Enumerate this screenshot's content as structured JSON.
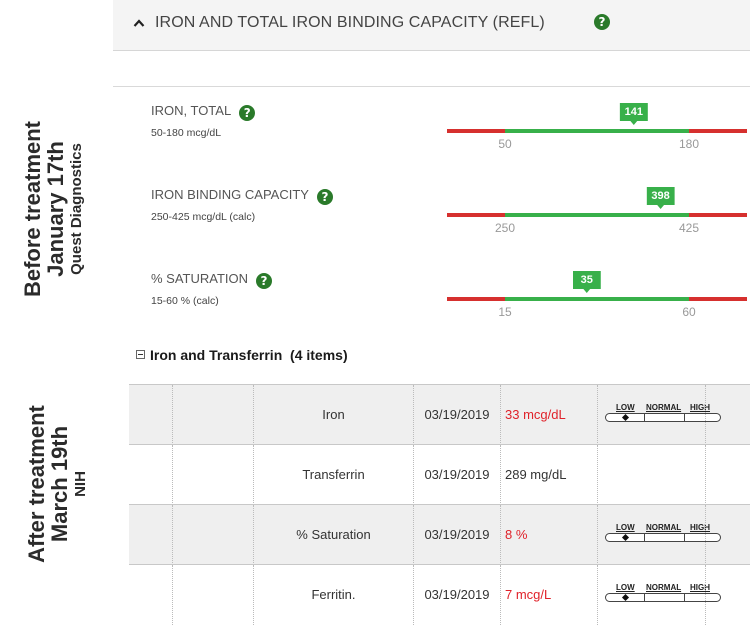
{
  "side_labels": {
    "before": {
      "line1": "Before treatment",
      "line2": "January 17th",
      "line3": "Quest Diagnostics"
    },
    "after": {
      "line1": "After treatment",
      "line2": "March 19th",
      "line3": "NIH"
    }
  },
  "panel": {
    "title": "IRON AND TOTAL IRON BINDING CAPACITY (REFL)",
    "collapse_icon": "chevron-up-icon",
    "help_icon": "question-circle-icon",
    "help_glyph": "?"
  },
  "results": [
    {
      "name": "IRON, TOTAL",
      "range": "50-180 mcg/dL",
      "low": 50,
      "high": 180,
      "low_label": "50",
      "high_label": "180",
      "value": 141,
      "value_label": "141"
    },
    {
      "name": "IRON BINDING CAPACITY",
      "range": "250-425 mcg/dL (calc)",
      "low": 250,
      "high": 425,
      "low_label": "250",
      "high_label": "425",
      "value": 398,
      "value_label": "398"
    },
    {
      "name": "% SATURATION",
      "range": "15-60 % (calc)",
      "low": 15,
      "high": 60,
      "low_label": "15",
      "high_label": "60",
      "value": 35,
      "value_label": "35"
    }
  ],
  "colors": {
    "in_range": "#38b04a",
    "out_of_range": "#d6302e",
    "abnormal_text": "#e0222a",
    "help": "#2a7a2a"
  },
  "group": {
    "title": "Iron and Transferrin",
    "count": "(4 items)",
    "toggle_icon": "collapse-box-icon",
    "scale_labels": {
      "low": "LOW",
      "normal": "NORMAL",
      "high": "HIGH"
    },
    "rows": [
      {
        "test": "Iron",
        "date": "03/19/2019",
        "result": "33 mcg/dL",
        "abnormal": true,
        "flag": "low",
        "shaded": true
      },
      {
        "test": "Transferrin",
        "date": "03/19/2019",
        "result": "289 mg/dL",
        "abnormal": false,
        "flag": "",
        "shaded": false
      },
      {
        "test": "% Saturation",
        "date": "03/19/2019",
        "result": "8 %",
        "abnormal": true,
        "flag": "low",
        "shaded": true
      },
      {
        "test": "Ferritin.",
        "date": "03/19/2019",
        "result": "7 mcg/L",
        "abnormal": true,
        "flag": "low",
        "shaded": false
      }
    ]
  }
}
